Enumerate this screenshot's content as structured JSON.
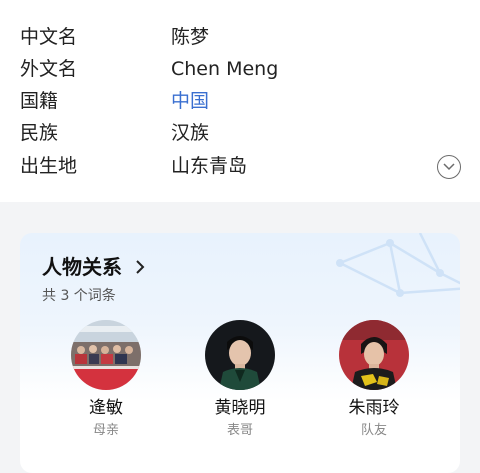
{
  "info": [
    {
      "key": "中文名",
      "value": "陈梦",
      "link": false
    },
    {
      "key": "外文名",
      "value": "Chen Meng",
      "link": false
    },
    {
      "key": "国籍",
      "value": "中国",
      "link": true
    },
    {
      "key": "民族",
      "value": "汉族",
      "link": false
    },
    {
      "key": "出生地",
      "value": "山东青岛",
      "link": false
    }
  ],
  "expand_icon": "chevron-down-circle-icon",
  "relations": {
    "title": "人物关系",
    "count_text": "共 3 个词条",
    "people": [
      {
        "name": "逄敏",
        "relation": "母亲"
      },
      {
        "name": "黄晓明",
        "relation": "表哥"
      },
      {
        "name": "朱雨玲",
        "relation": "队友"
      }
    ]
  },
  "colors": {
    "link": "#3a6fd0",
    "card_gradient_top": "#e8f2fd"
  }
}
